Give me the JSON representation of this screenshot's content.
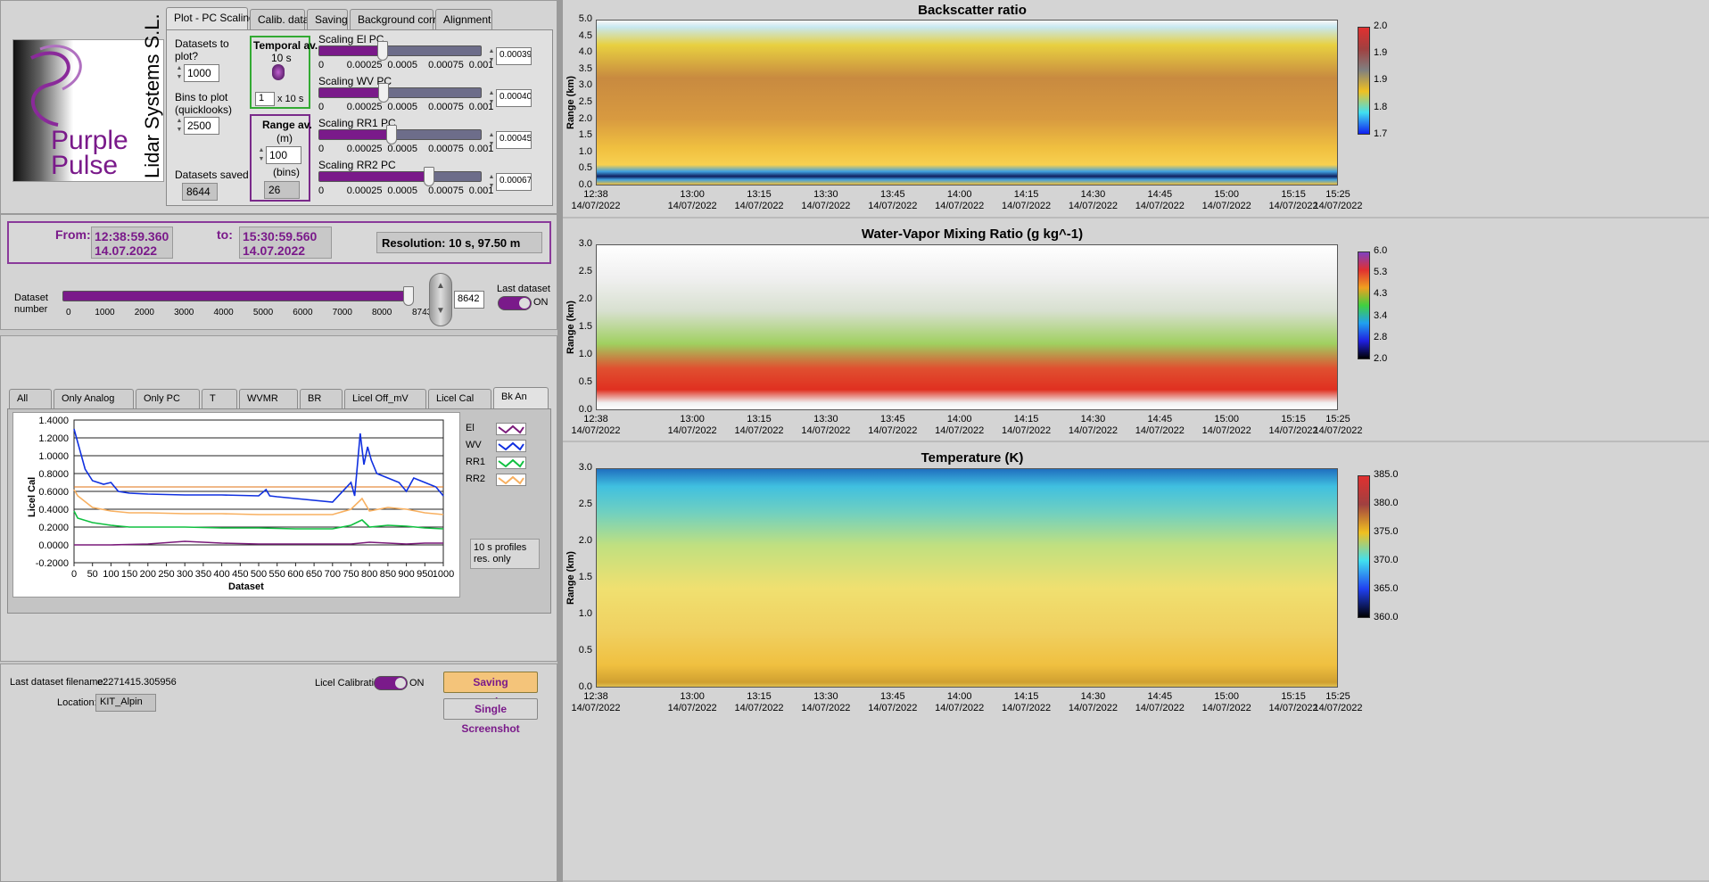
{
  "tabs_top": [
    "Plot - PC Scaling",
    "Calib. data",
    "Saving",
    "Background corr.",
    "Alignment"
  ],
  "logo": {
    "word1": "Purple",
    "word2": "Pulse",
    "company": "Lidar Systems S.L."
  },
  "controls": {
    "datasets_to_plot_label": "Datasets to plot?",
    "datasets_to_plot_value": "1000",
    "bins_to_plot_label": "Bins to plot (quicklooks)",
    "bins_to_plot_value": "2500",
    "datasets_saved_label": "Datasets saved",
    "datasets_saved_value": "8644",
    "temporal_av_label": "Temporal av.",
    "temporal_av_unit": "10 s",
    "temporal_av_value": "1",
    "temporal_av_suffix": "x 10 s",
    "range_av_label": "Range av.",
    "range_av_unit": "(m)",
    "range_av_value": "100",
    "range_av_bins_label": "(bins)",
    "range_av_bins_value": "26"
  },
  "scaling_sliders": [
    {
      "label": "Scaling El PC",
      "value": "0.000394",
      "fraction": 0.394
    },
    {
      "label": "Scaling WV PC",
      "value": "0.000400",
      "fraction": 0.4
    },
    {
      "label": "Scaling RR1 PC",
      "value": "0.00045",
      "fraction": 0.45
    },
    {
      "label": "Scaling RR2 PC",
      "value": "0.000677",
      "fraction": 0.677
    }
  ],
  "slider_scale": [
    "0",
    "0.00025",
    "0.0005",
    "0.00075",
    "0.001"
  ],
  "time_range": {
    "from_label": "From:",
    "from_time": "12:38:59.360",
    "from_date": "14.07.2022",
    "to_label": "to:",
    "to_time": "15:30:59.560",
    "to_date": "14.07.2022",
    "resolution": "Resolution: 10 s, 97.50 m"
  },
  "dataset": {
    "label": "Dataset number",
    "value": "8642",
    "max": 8743,
    "scale": [
      "0",
      "1000",
      "2000",
      "3000",
      "4000",
      "5000",
      "6000",
      "7000",
      "8000",
      "8743"
    ],
    "last_dataset_label": "Last dataset",
    "last_dataset_state": "ON"
  },
  "tabs_bottom": [
    "All",
    "Only Analog",
    "Only PC",
    "T",
    "WVMR",
    "BR",
    "Licel Off_mV",
    "Licel Cal",
    "Bk An"
  ],
  "chart_data": {
    "type": "line",
    "title": "",
    "xlabel": "Dataset",
    "ylabel": "Licel Cal",
    "xlim": [
      0,
      1000
    ],
    "ylim": [
      -0.2,
      1.4
    ],
    "xticks": [
      "0",
      "50",
      "100",
      "150",
      "200",
      "250",
      "300",
      "350",
      "400",
      "450",
      "500",
      "550",
      "600",
      "650",
      "700",
      "750",
      "800",
      "850",
      "900",
      "950",
      "1000"
    ],
    "yticks": [
      "1.4000",
      "1.2000",
      "1.0000",
      "0.8000",
      "0.6000",
      "0.4000",
      "0.2000",
      "0.0000",
      "-0.2000"
    ],
    "series": [
      {
        "name": "El",
        "color": "#7a1a7a",
        "x": [
          0,
          100,
          200,
          300,
          400,
          500,
          600,
          700,
          750,
          800,
          850,
          900,
          950,
          1000
        ],
        "values": [
          0.0,
          0.0,
          0.01,
          0.04,
          0.02,
          0.01,
          0.01,
          0.01,
          0.01,
          0.03,
          0.02,
          0.01,
          0.02,
          0.02
        ]
      },
      {
        "name": "WV",
        "color": "#1030e0",
        "x": [
          0,
          10,
          30,
          50,
          80,
          100,
          120,
          150,
          200,
          300,
          400,
          500,
          520,
          530,
          550,
          600,
          700,
          750,
          760,
          775,
          785,
          795,
          805,
          820,
          850,
          880,
          900,
          920,
          950,
          980,
          1000
        ],
        "values": [
          1.3,
          1.15,
          0.85,
          0.72,
          0.68,
          0.7,
          0.6,
          0.58,
          0.57,
          0.56,
          0.56,
          0.55,
          0.62,
          0.55,
          0.54,
          0.52,
          0.48,
          0.7,
          0.55,
          1.25,
          0.9,
          1.1,
          0.95,
          0.8,
          0.75,
          0.7,
          0.6,
          0.75,
          0.7,
          0.65,
          0.55
        ]
      },
      {
        "name": "RR1",
        "color": "#10c040",
        "x": [
          0,
          10,
          50,
          100,
          150,
          200,
          300,
          400,
          500,
          600,
          700,
          750,
          780,
          800,
          850,
          900,
          950,
          1000
        ],
        "values": [
          0.38,
          0.3,
          0.25,
          0.22,
          0.2,
          0.2,
          0.2,
          0.19,
          0.19,
          0.18,
          0.18,
          0.22,
          0.28,
          0.2,
          0.22,
          0.21,
          0.19,
          0.18
        ]
      },
      {
        "name": "RR2",
        "color": "#f8b060",
        "x": [
          0,
          10,
          50,
          100,
          150,
          200,
          300,
          400,
          500,
          600,
          700,
          750,
          780,
          800,
          850,
          900,
          950,
          1000
        ],
        "values": [
          0.62,
          0.55,
          0.42,
          0.38,
          0.36,
          0.36,
          0.35,
          0.35,
          0.34,
          0.34,
          0.34,
          0.4,
          0.52,
          0.38,
          0.42,
          0.4,
          0.36,
          0.34
        ]
      }
    ]
  },
  "chart_note": "10 s profiles res. only",
  "footer": {
    "last_filename_label": "Last dataset filename:",
    "last_filename_value": "e2271415.305956",
    "location_label": "Location:",
    "location_value": "KIT_Alpin",
    "licel_cal_label": "Licel Calibration",
    "licel_cal_state": "ON",
    "btn_saving": "Saving screenshots...",
    "btn_single": "Single Screenshot"
  },
  "right_plots": {
    "xticks": [
      "12:38\n14/07/2022",
      "13:00\n14/07/2022",
      "13:15\n14/07/2022",
      "13:30\n14/07/2022",
      "13:45\n14/07/2022",
      "14:00\n14/07/2022",
      "14:15\n14/07/2022",
      "14:30\n14/07/2022",
      "14:45\n14/07/2022",
      "15:00\n14/07/2022",
      "15:15\n14/07/2022",
      "15:25\n14/07/2022"
    ],
    "ylabel": "Range (km)",
    "backscatter": {
      "title": "Backscatter ratio",
      "yticks": [
        "5.0",
        "4.5",
        "4.0",
        "3.5",
        "3.0",
        "2.5",
        "2.0",
        "1.5",
        "1.0",
        "0.5",
        "0.0"
      ],
      "cbar": [
        "2.0",
        "1.9",
        "1.9",
        "1.8",
        "1.7"
      ]
    },
    "wvmr": {
      "title": "Water-Vapor Mixing Ratio  (g kg^-1)",
      "yticks": [
        "3.0",
        "2.5",
        "2.0",
        "1.5",
        "1.0",
        "0.5",
        "0.0"
      ],
      "cbar": [
        "6.0",
        "5.3",
        "4.3",
        "3.4",
        "2.8",
        "2.0"
      ]
    },
    "temperature": {
      "title": "Temperature (K)",
      "yticks": [
        "3.0",
        "2.5",
        "2.0",
        "1.5",
        "1.0",
        "0.5",
        "0.0"
      ],
      "cbar": [
        "385.0",
        "380.0",
        "375.0",
        "370.0",
        "365.0",
        "360.0"
      ]
    }
  }
}
